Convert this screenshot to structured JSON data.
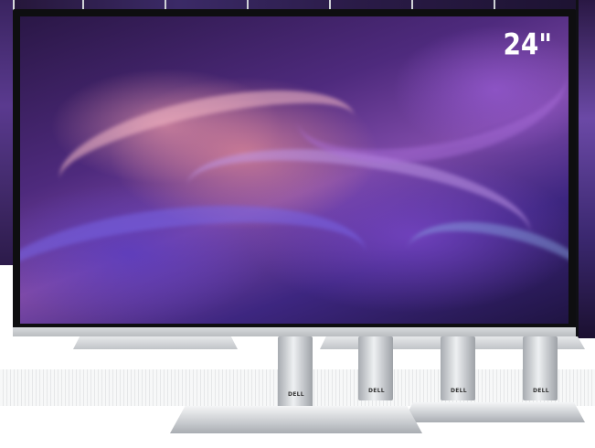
{
  "product": {
    "screen_size_label": "24\"",
    "brand_badges": [
      "DELL",
      "DELL",
      "DELL",
      "DELL"
    ]
  },
  "colors": {
    "bezel": "#0e0e10",
    "stand_silver": "#c9ccd0",
    "wallpaper_purple": "#4e2a7d",
    "wallpaper_pink": "#d68296",
    "label_text": "#ffffff"
  }
}
